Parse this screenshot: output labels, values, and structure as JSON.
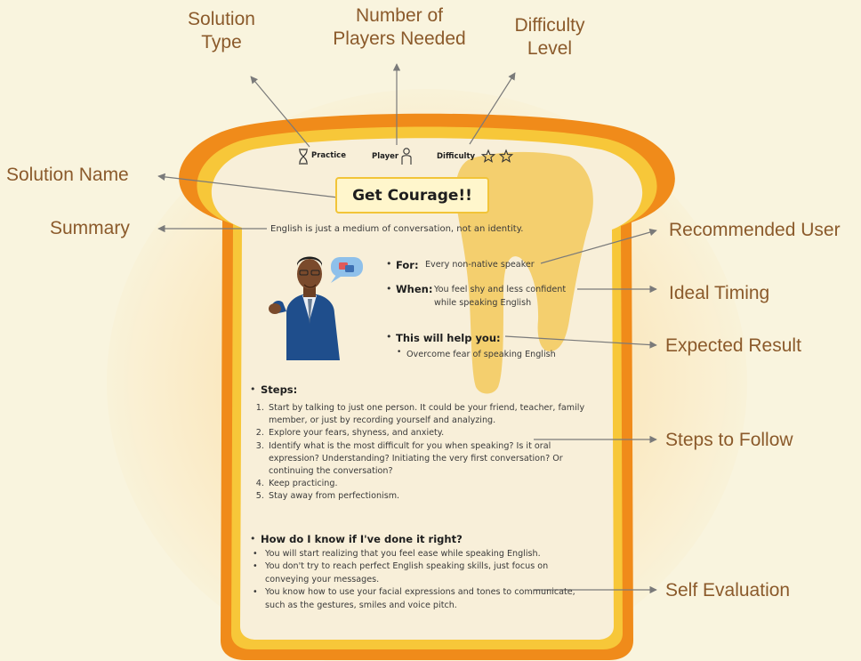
{
  "callouts": {
    "solution_type": [
      "Solution",
      "Type"
    ],
    "players_needed": [
      "Number of",
      "Players Needed"
    ],
    "difficulty_level": [
      "Difficulty",
      "Level"
    ],
    "solution_name": "Solution Name",
    "summary": "Summary",
    "recommended_user": "Recommended User",
    "ideal_timing": "Ideal Timing",
    "expected_result": "Expected Result",
    "steps_to_follow": "Steps to Follow",
    "self_evaluation": "Self Evaluation"
  },
  "card": {
    "type_label": "Practice",
    "player_label": "Player",
    "difficulty_label": "Difficulty",
    "difficulty_stars": 2,
    "title": "Get Courage!!",
    "summary": "English is just a medium of conversation, not an identity.",
    "for_label": "For:",
    "for_value": "Every non-native speaker",
    "when_label": "When:",
    "when_value_1": "You feel shy and less confident",
    "when_value_2": "while speaking English",
    "help_label": "This will help you:",
    "help_value": "Overcome fear of speaking English",
    "steps_label": "Steps:",
    "steps": [
      "Start by talking to just one person. It could be your friend, teacher, family member, or just by recording yourself and analyzing.",
      "Explore your fears, shyness, and anxiety.",
      "Identify what is the most difficult for you when speaking? Is it oral expression? Understanding? Initiating the very first conversation? Or continuing the conversation?",
      "Keep practicing.",
      "Stay away from perfectionism."
    ],
    "eval_label": "How do I know if I've done it right?",
    "eval_items": [
      "You will start realizing that you feel ease while speaking English.",
      "You don't try to reach perfect English speaking skills, just focus on conveying your messages.",
      "You know how to use your facial expressions and tones to communicate, such as the gestures, smiles and voice pitch."
    ]
  },
  "colors": {
    "background": "#f9f4de",
    "crust_outer": "#f08b1a",
    "crust_inner": "#f7c739",
    "bread": "#f8efd9",
    "honey": "#f3c44a",
    "callout_text": "#8b5a2b",
    "arrow": "#7a7a7a"
  }
}
